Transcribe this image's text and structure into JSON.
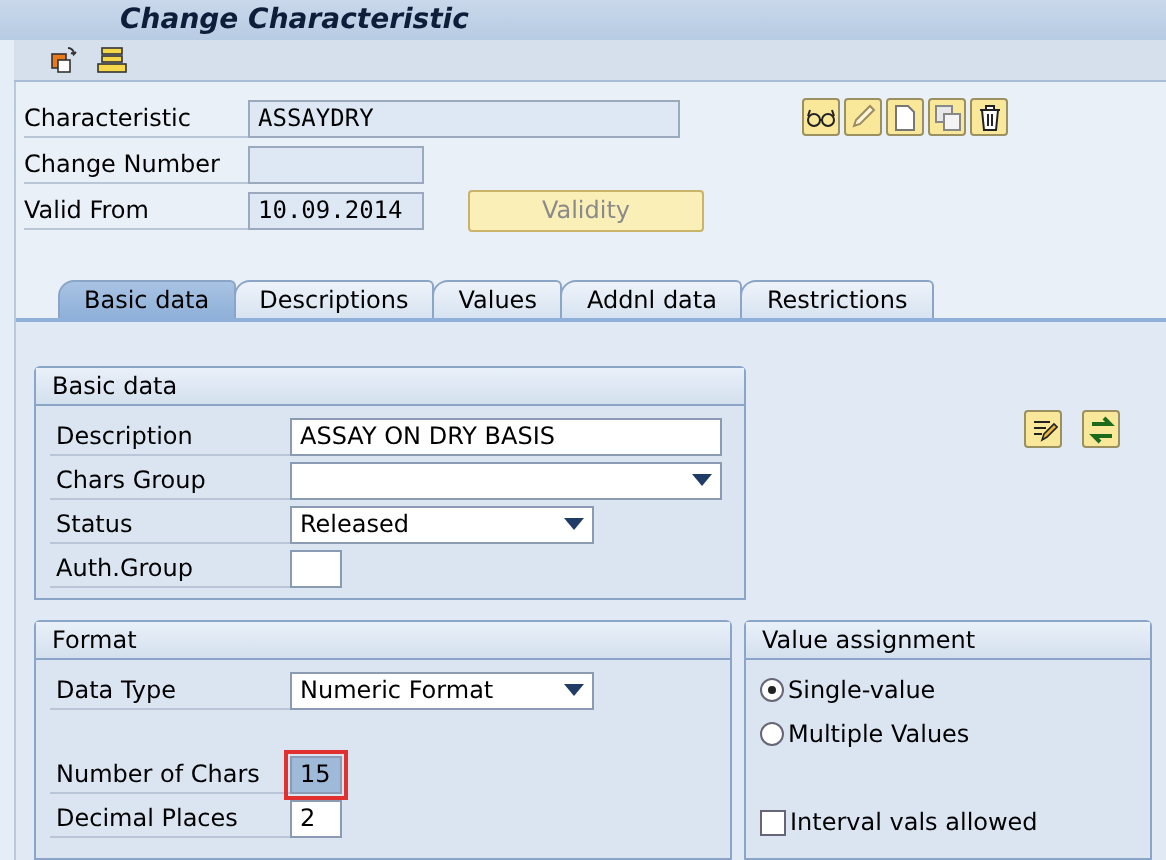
{
  "window": {
    "title": "Change Characteristic"
  },
  "header": {
    "fields": [
      {
        "label": "Characteristic",
        "value": "ASSAYDRY"
      },
      {
        "label": "Change Number"
      },
      {
        "label": "Valid From",
        "value": "10.09.2014"
      }
    ],
    "validity_button": {
      "label": "Validity",
      "disabled": true
    }
  },
  "tabs": [
    {
      "label": "Basic data",
      "selected": true
    },
    {
      "label": "Descriptions",
      "selected": false
    },
    {
      "label": "Values",
      "selected": false
    },
    {
      "label": "Addnl data",
      "selected": false
    },
    {
      "label": "Restrictions",
      "selected": false
    }
  ],
  "basic_data": {
    "title": "Basic data",
    "fields": [
      {
        "label": "Description",
        "kind": "text",
        "value": "ASSAY ON DRY BASIS"
      },
      {
        "label": "Chars Group",
        "kind": "dropdown"
      },
      {
        "label": "Status",
        "kind": "dropdown",
        "value": "Released"
      },
      {
        "label": "Auth.Group",
        "kind": "text"
      }
    ]
  },
  "format": {
    "title": "Format",
    "fields": [
      {
        "label": "Data Type",
        "kind": "dropdown",
        "value": "Numeric Format"
      },
      {
        "label": "Number of Chars",
        "kind": "text",
        "value": "15",
        "focused": true
      },
      {
        "label": "Decimal Places",
        "kind": "text",
        "value": "2",
        "focused": false
      }
    ]
  },
  "value_assignment": {
    "title": "Value assignment",
    "options": [
      {
        "label": "Single-value",
        "selected": true
      },
      {
        "label": "Multiple Values",
        "selected": false
      }
    ],
    "interval": {
      "label": "Interval vals allowed",
      "checked": false
    }
  }
}
